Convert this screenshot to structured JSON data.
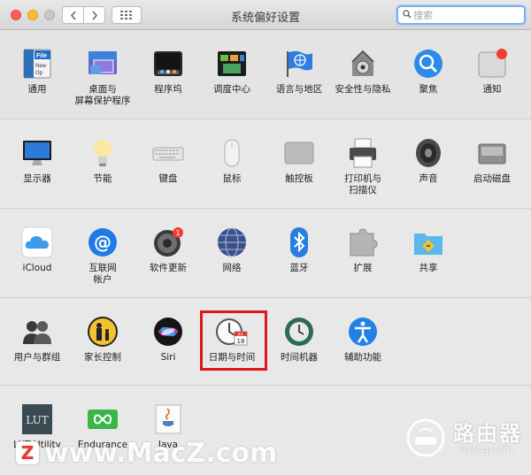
{
  "window": {
    "title": "系统偏好设置",
    "search_placeholder": "搜索"
  },
  "sections": [
    {
      "panes": [
        {
          "id": "general",
          "label": "通用",
          "icon": "general-icon"
        },
        {
          "id": "desktop",
          "label": "桌面与\n屏幕保护程序",
          "icon": "desktop-screensaver-icon"
        },
        {
          "id": "dock",
          "label": "程序坞",
          "icon": "dock-icon"
        },
        {
          "id": "mission",
          "label": "调度中心",
          "icon": "mission-control-icon"
        },
        {
          "id": "language",
          "label": "语言与地区",
          "icon": "language-region-icon"
        },
        {
          "id": "security",
          "label": "安全性与隐私",
          "icon": "security-privacy-icon"
        },
        {
          "id": "spotlight",
          "label": "聚焦",
          "icon": "spotlight-icon"
        },
        {
          "id": "notifications",
          "label": "通知",
          "icon": "notifications-icon"
        }
      ]
    },
    {
      "panes": [
        {
          "id": "displays",
          "label": "显示器",
          "icon": "displays-icon"
        },
        {
          "id": "energy",
          "label": "节能",
          "icon": "energy-saver-icon"
        },
        {
          "id": "keyboard",
          "label": "键盘",
          "icon": "keyboard-icon"
        },
        {
          "id": "mouse",
          "label": "鼠标",
          "icon": "mouse-icon"
        },
        {
          "id": "trackpad",
          "label": "触控板",
          "icon": "trackpad-icon"
        },
        {
          "id": "printers",
          "label": "打印机与\n扫描仪",
          "icon": "printers-scanners-icon"
        },
        {
          "id": "sound",
          "label": "声音",
          "icon": "sound-icon"
        },
        {
          "id": "startup",
          "label": "启动磁盘",
          "icon": "startup-disk-icon"
        }
      ]
    },
    {
      "panes": [
        {
          "id": "icloud",
          "label": "iCloud",
          "icon": "icloud-icon"
        },
        {
          "id": "internet",
          "label": "互联网\n帐户",
          "icon": "internet-accounts-icon"
        },
        {
          "id": "update",
          "label": "软件更新",
          "icon": "software-update-icon",
          "badge": "1"
        },
        {
          "id": "network",
          "label": "网络",
          "icon": "network-icon"
        },
        {
          "id": "bluetooth",
          "label": "蓝牙",
          "icon": "bluetooth-icon"
        },
        {
          "id": "extensions",
          "label": "扩展",
          "icon": "extensions-icon"
        },
        {
          "id": "sharing",
          "label": "共享",
          "icon": "sharing-icon"
        }
      ]
    },
    {
      "panes": [
        {
          "id": "users",
          "label": "用户与群组",
          "icon": "users-groups-icon"
        },
        {
          "id": "parental",
          "label": "家长控制",
          "icon": "parental-controls-icon"
        },
        {
          "id": "siri",
          "label": "Siri",
          "icon": "siri-icon"
        },
        {
          "id": "datetime",
          "label": "日期与时间",
          "icon": "date-time-icon",
          "calendar_day": "18",
          "calendar_month": "JUL"
        },
        {
          "id": "timemachine",
          "label": "时间机器",
          "icon": "time-machine-icon"
        },
        {
          "id": "accessibility",
          "label": "辅助功能",
          "icon": "accessibility-icon"
        }
      ]
    },
    {
      "panes": [
        {
          "id": "lututility",
          "label": "LUT Utility",
          "icon": "lut-utility-icon",
          "icon_text": "LUT"
        },
        {
          "id": "endurance",
          "label": "Endurance",
          "icon": "endurance-icon"
        },
        {
          "id": "java",
          "label": "Java",
          "icon": "java-icon"
        }
      ]
    }
  ],
  "general_icon_text": "File\nNew\nOp",
  "watermark": {
    "text": "www.MacZ.com",
    "badge": "Z",
    "router_cn": "路由器",
    "router_en": "luyouqi.com"
  }
}
